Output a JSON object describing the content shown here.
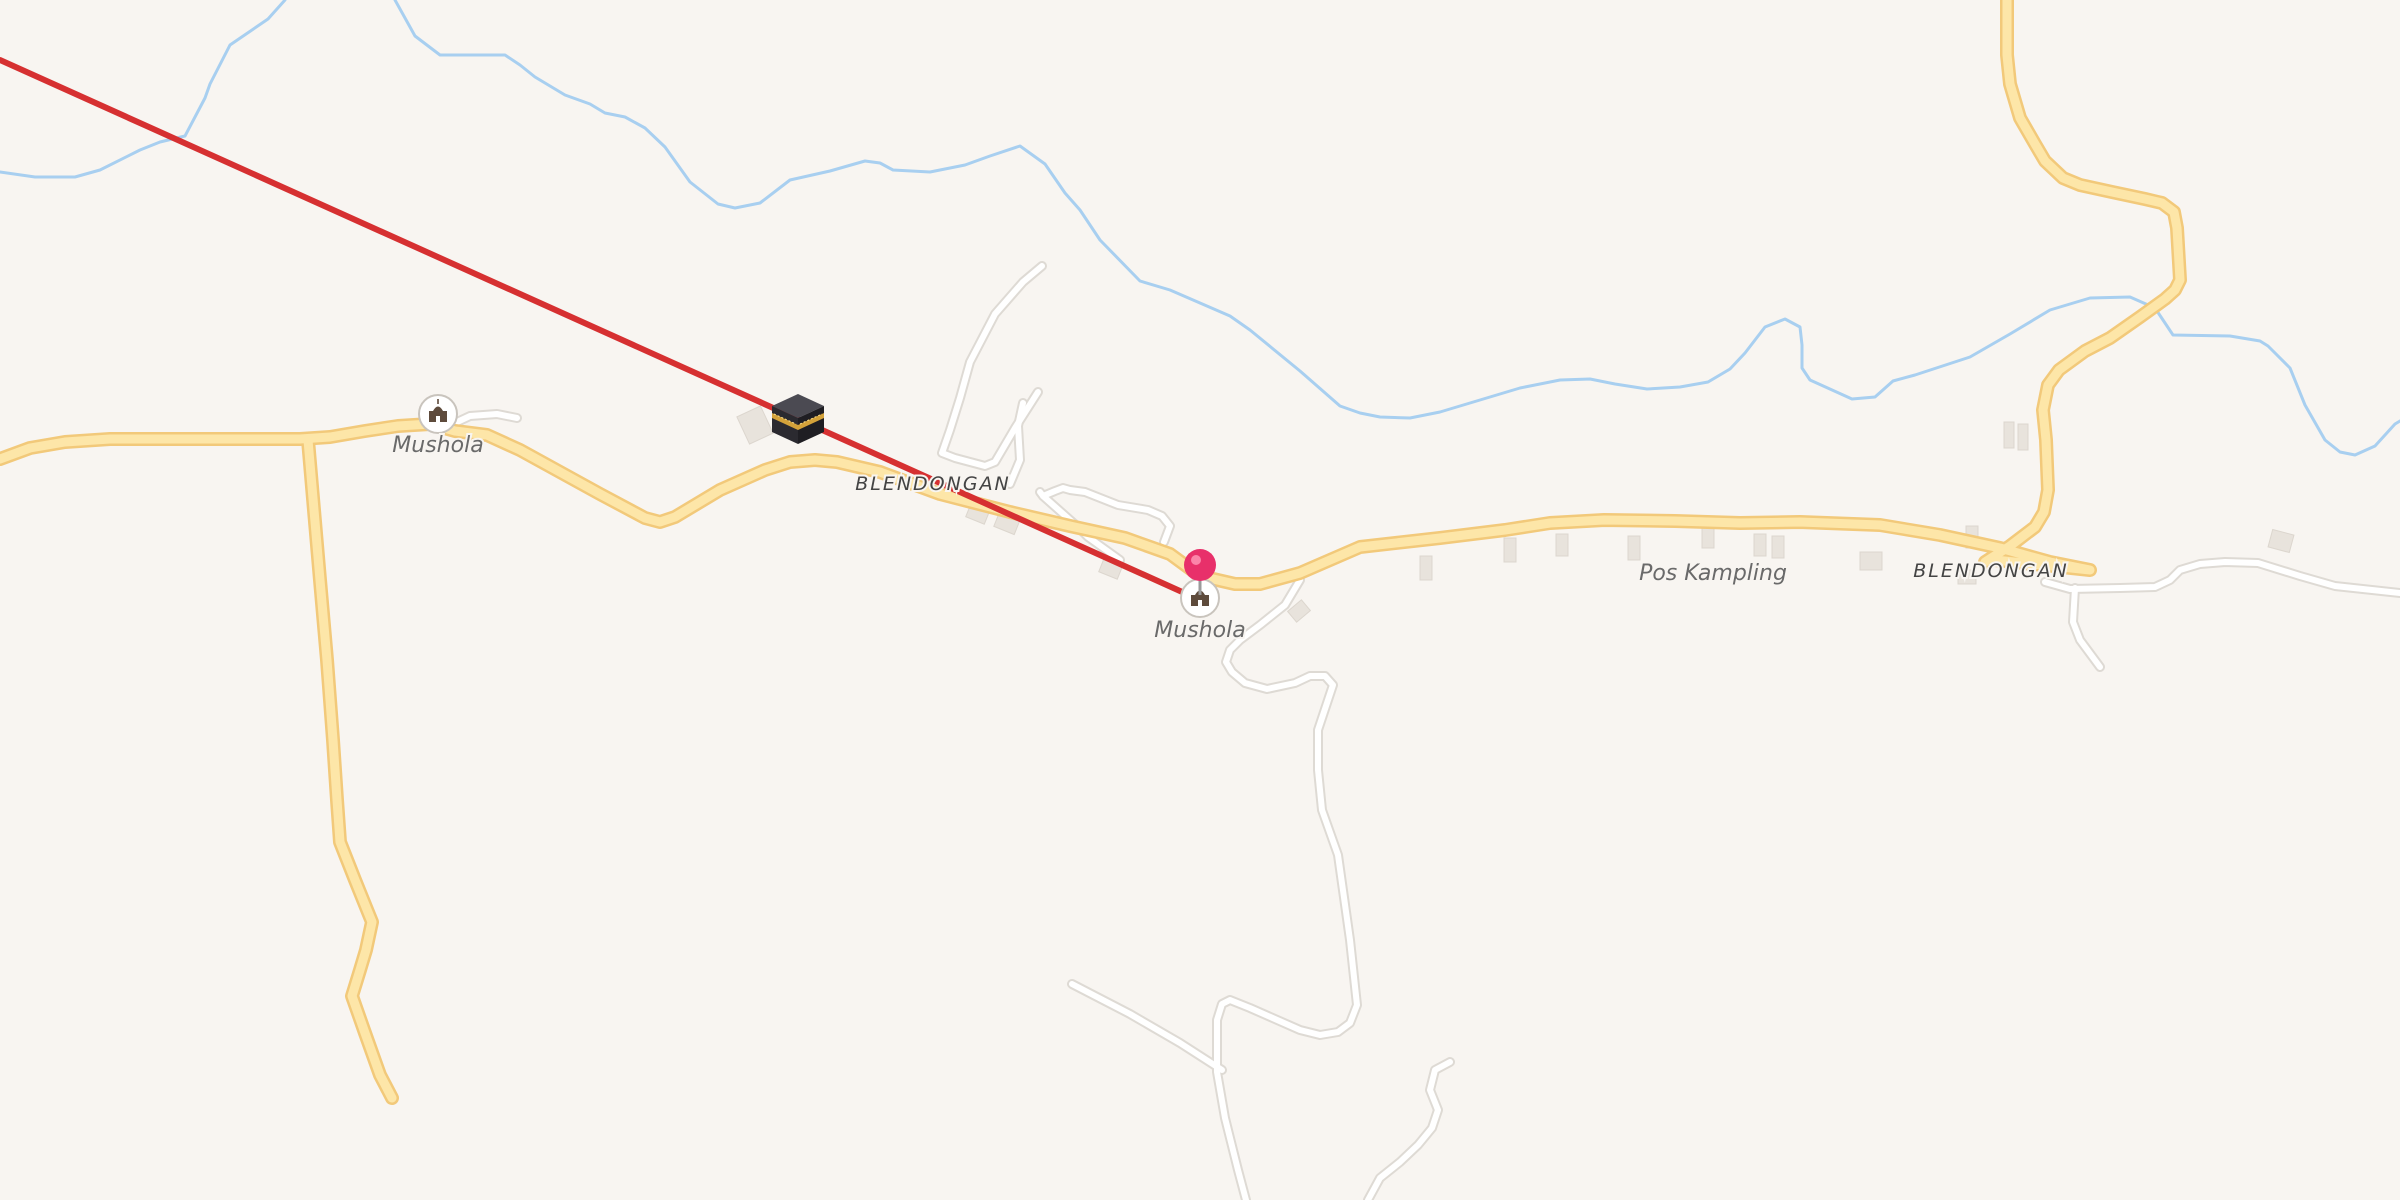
{
  "map": {
    "colors": {
      "background": "#f8f5f1",
      "major_road_fill": "#fde6a8",
      "major_road_casing": "#f2c97a",
      "minor_road": "#ffffff",
      "river": "#a8cff0",
      "route_line": "#d63031",
      "pin": "#e8306a",
      "building": "#e8e3dc"
    },
    "labels": {
      "mushola_west": "Mushola",
      "mushola_center": "Mushola",
      "blendongan_west": "BLENDONGAN",
      "blendongan_east": "BLENDONGAN",
      "pos_kampling": "Pos Kampling"
    },
    "icons": {
      "mushola_west": "mosque-icon",
      "mushola_center": "mosque-icon",
      "qibla": "kaaba-icon",
      "selected_location": "map-pin-icon"
    }
  }
}
